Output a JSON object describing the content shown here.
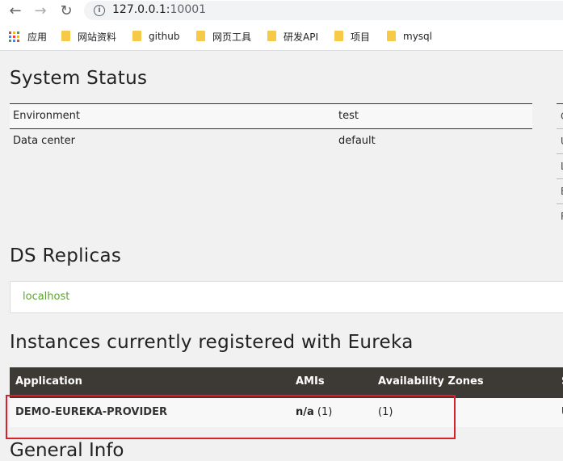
{
  "browser": {
    "url_host": "127.0.0.1:",
    "url_port": "10001",
    "bookmarks": [
      {
        "label": "应用",
        "icon": "apps-grid-icon"
      },
      {
        "label": "网站资料",
        "icon": "folder-icon"
      },
      {
        "label": "github",
        "icon": "folder-icon"
      },
      {
        "label": "网页工具",
        "icon": "folder-icon"
      },
      {
        "label": "研发API",
        "icon": "folder-icon"
      },
      {
        "label": "项目",
        "icon": "folder-icon"
      },
      {
        "label": "mysql",
        "icon": "folder-icon"
      }
    ]
  },
  "system_status": {
    "title": "System Status",
    "rows": [
      {
        "key": "Environment",
        "value": "test"
      },
      {
        "key": "Data center",
        "value": "default"
      }
    ],
    "side_cells": [
      "C",
      "U",
      "L",
      "E",
      "R"
    ]
  },
  "ds_replicas": {
    "title": "DS Replicas",
    "items": [
      "localhost"
    ]
  },
  "instances": {
    "title": "Instances currently registered with Eureka",
    "headers": [
      "Application",
      "AMIs",
      "Availability Zones",
      "S"
    ],
    "rows": [
      {
        "application": "DEMO-EUREKA-PROVIDER",
        "amis_bold": "n/a",
        "amis_count": "(1)",
        "zones": "(1)",
        "status": "U"
      }
    ]
  },
  "general_info": {
    "title": "General Info"
  },
  "colors": {
    "link": "#5fa134",
    "header_bg": "#3d3a36",
    "highlight": "#d9202b"
  }
}
